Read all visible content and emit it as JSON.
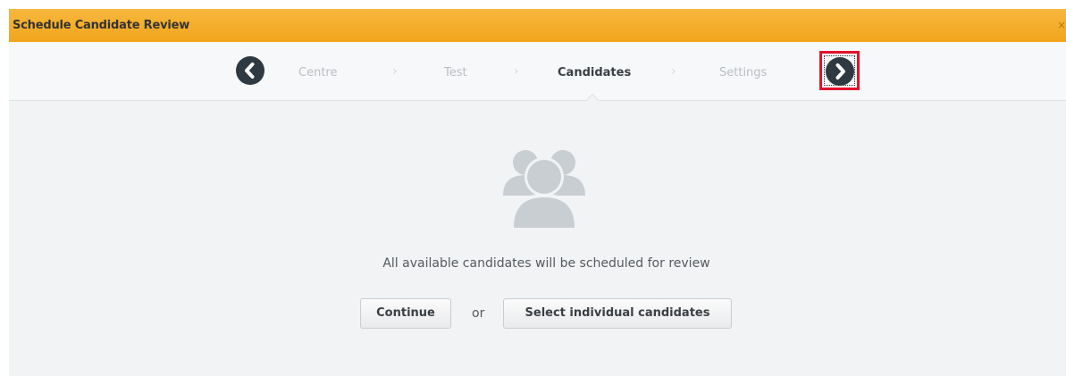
{
  "dialog": {
    "title": "Schedule Candidate Review",
    "close_symbol": "×"
  },
  "wizard": {
    "steps": [
      {
        "label": "Centre",
        "state": "inactive"
      },
      {
        "label": "Test",
        "state": "inactive"
      },
      {
        "label": "Candidates",
        "state": "active"
      },
      {
        "label": "Settings",
        "state": "inactive"
      }
    ],
    "separator": "›",
    "prev_icon": "chevron-left-icon",
    "next_icon": "chevron-right-icon"
  },
  "content": {
    "icon": "users-group-icon",
    "message": "All available candidates will be scheduled for review",
    "continue_label": "Continue",
    "or_label": "or",
    "select_label": "Select individual candidates"
  },
  "colors": {
    "titlebar": "#f1a51c",
    "nav_button": "#2f3941",
    "highlight": "#e3102c",
    "content_background": "#f2f3f5",
    "icon": "#c9ced3"
  }
}
